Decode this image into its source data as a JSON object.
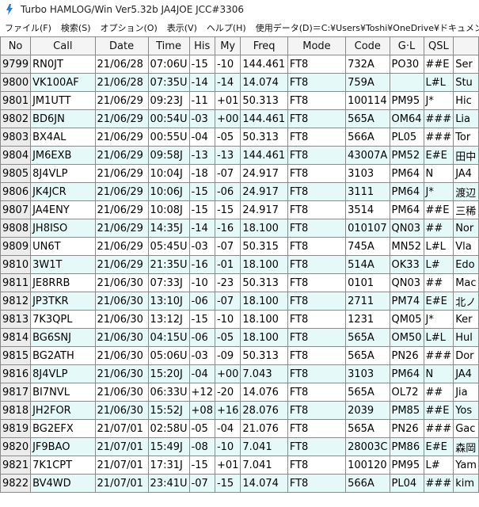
{
  "window": {
    "title": "Turbo HAMLOG/Win Ver5.32b JA4JOE JCC#3306"
  },
  "menu": {
    "items": [
      "ファイル(F)",
      "検索(S)",
      "オプション(O)",
      "表示(V)",
      "ヘルプ(H)"
    ],
    "path_label": "使用データ(D)＝C:¥Users¥Toshi¥OneDrive¥ドキュメント¥HAMLOG¥"
  },
  "table": {
    "columns": [
      "No",
      "Call",
      "Date",
      "Time",
      "His",
      "My",
      "Freq",
      "Mode",
      "Code",
      "G·L",
      "QSL",
      ""
    ],
    "rows": [
      [
        "9799",
        "RN0JT",
        "21/06/28",
        "07:06U",
        "-15",
        "-10",
        "144.461",
        "FT8",
        "732A",
        "PO30",
        "##E",
        "Ser"
      ],
      [
        "9800",
        "VK100AF",
        "21/06/28",
        "07:35U",
        "-14",
        "-14",
        "14.074",
        "FT8",
        "759A",
        "",
        "L#L",
        "Stu"
      ],
      [
        "9801",
        "JM1UTT",
        "21/06/29",
        "09:23J",
        "-11",
        "+01",
        "50.313",
        "FT8",
        "100114",
        "PM95",
        "J*",
        "Hic"
      ],
      [
        "9802",
        "BD6JN",
        "21/06/29",
        "00:54U",
        "-03",
        "+00",
        "144.461",
        "FT8",
        "565A",
        "OM64",
        "###",
        "Lia"
      ],
      [
        "9803",
        "BX4AL",
        "21/06/29",
        "00:55U",
        "-04",
        "-05",
        "50.313",
        "FT8",
        "566A",
        "PL05",
        "###",
        "Tor"
      ],
      [
        "9804",
        "JM6EXB",
        "21/06/29",
        "09:58J",
        "-13",
        "-13",
        "144.461",
        "FT8",
        "43007A",
        "PM52",
        "E#E",
        "田中"
      ],
      [
        "9805",
        "8J4VLP",
        "21/06/29",
        "10:04J",
        "-18",
        "-07",
        "24.917",
        "FT8",
        "3103",
        "PM64",
        "N",
        "JA4"
      ],
      [
        "9806",
        "JK4JCR",
        "21/06/29",
        "10:06J",
        "-15",
        "-06",
        "24.917",
        "FT8",
        "3111",
        "PM64",
        "J*",
        "渡辺"
      ],
      [
        "9807",
        "JA4ENY",
        "21/06/29",
        "10:08J",
        "-15",
        "-15",
        "24.917",
        "FT8",
        "3514",
        "PM64",
        "##E",
        "三稀"
      ],
      [
        "9808",
        "JH8ISO",
        "21/06/29",
        "14:35J",
        "-14",
        "-16",
        "18.100",
        "FT8",
        "010107",
        "QN03",
        "##",
        "Nor"
      ],
      [
        "9809",
        "UN6T",
        "21/06/29",
        "05:45U",
        "-03",
        "-07",
        "50.315",
        "FT8",
        "745A",
        "MN52",
        "L#L",
        "Vla"
      ],
      [
        "9810",
        "3W1T",
        "21/06/29",
        "21:35U",
        "-16",
        "-01",
        "18.100",
        "FT8",
        "514A",
        "OK33",
        "L#",
        "Edo"
      ],
      [
        "9811",
        "JE8RRB",
        "21/06/30",
        "07:33J",
        "-10",
        "-23",
        "50.313",
        "FT8",
        "0101",
        "QN03",
        "##",
        "Mac"
      ],
      [
        "9812",
        "JP3TKR",
        "21/06/30",
        "13:10J",
        "-06",
        "-07",
        "18.100",
        "FT8",
        "2711",
        "PM74",
        "E#E",
        "北ノ"
      ],
      [
        "9813",
        "7K3QPL",
        "21/06/30",
        "13:12J",
        "-15",
        "-10",
        "18.100",
        "FT8",
        "1231",
        "QM05",
        "J*",
        "Ker"
      ],
      [
        "9814",
        "BG6SNJ",
        "21/06/30",
        "04:15U",
        "-06",
        "-05",
        "18.100",
        "FT8",
        "565A",
        "OM50",
        "L#L",
        "Hul"
      ],
      [
        "9815",
        "BG2ATH",
        "21/06/30",
        "05:06U",
        "-03",
        "-09",
        "50.313",
        "FT8",
        "565A",
        "PN26",
        "###",
        "Dor"
      ],
      [
        "9816",
        "8J4VLP",
        "21/06/30",
        "15:20J",
        "-04",
        "+00",
        "7.043",
        "FT8",
        "3103",
        "PM64",
        "N",
        "JA4"
      ],
      [
        "9817",
        "BI7NVL",
        "21/06/30",
        "06:33U",
        "+12",
        "-20",
        "14.076",
        "FT8",
        "565A",
        "OL72",
        "##",
        "Jia"
      ],
      [
        "9818",
        "JH2FOR",
        "21/06/30",
        "15:52J",
        "+08",
        "+16",
        "28.076",
        "FT8",
        "2039",
        "PM85",
        "##E",
        "Yos"
      ],
      [
        "9819",
        "BG2EFX",
        "21/07/01",
        "02:58U",
        "-05",
        "-04",
        "21.076",
        "FT8",
        "565A",
        "PN26",
        "###",
        "Gac"
      ],
      [
        "9820",
        "JF9BAO",
        "21/07/01",
        "15:49J",
        "-08",
        "-10",
        "7.041",
        "FT8",
        "28003C",
        "PM86",
        "E#E",
        "森岡"
      ],
      [
        "9821",
        "7K1CPT",
        "21/07/01",
        "17:31J",
        "-15",
        "+01",
        "7.041",
        "FT8",
        "100120",
        "PM95",
        "L#",
        "Yam"
      ],
      [
        "9822",
        "BV4WD",
        "21/07/01",
        "23:41U",
        "-07",
        "-15",
        "14.074",
        "FT8",
        "566A",
        "PL04",
        "###",
        "kim"
      ]
    ]
  }
}
